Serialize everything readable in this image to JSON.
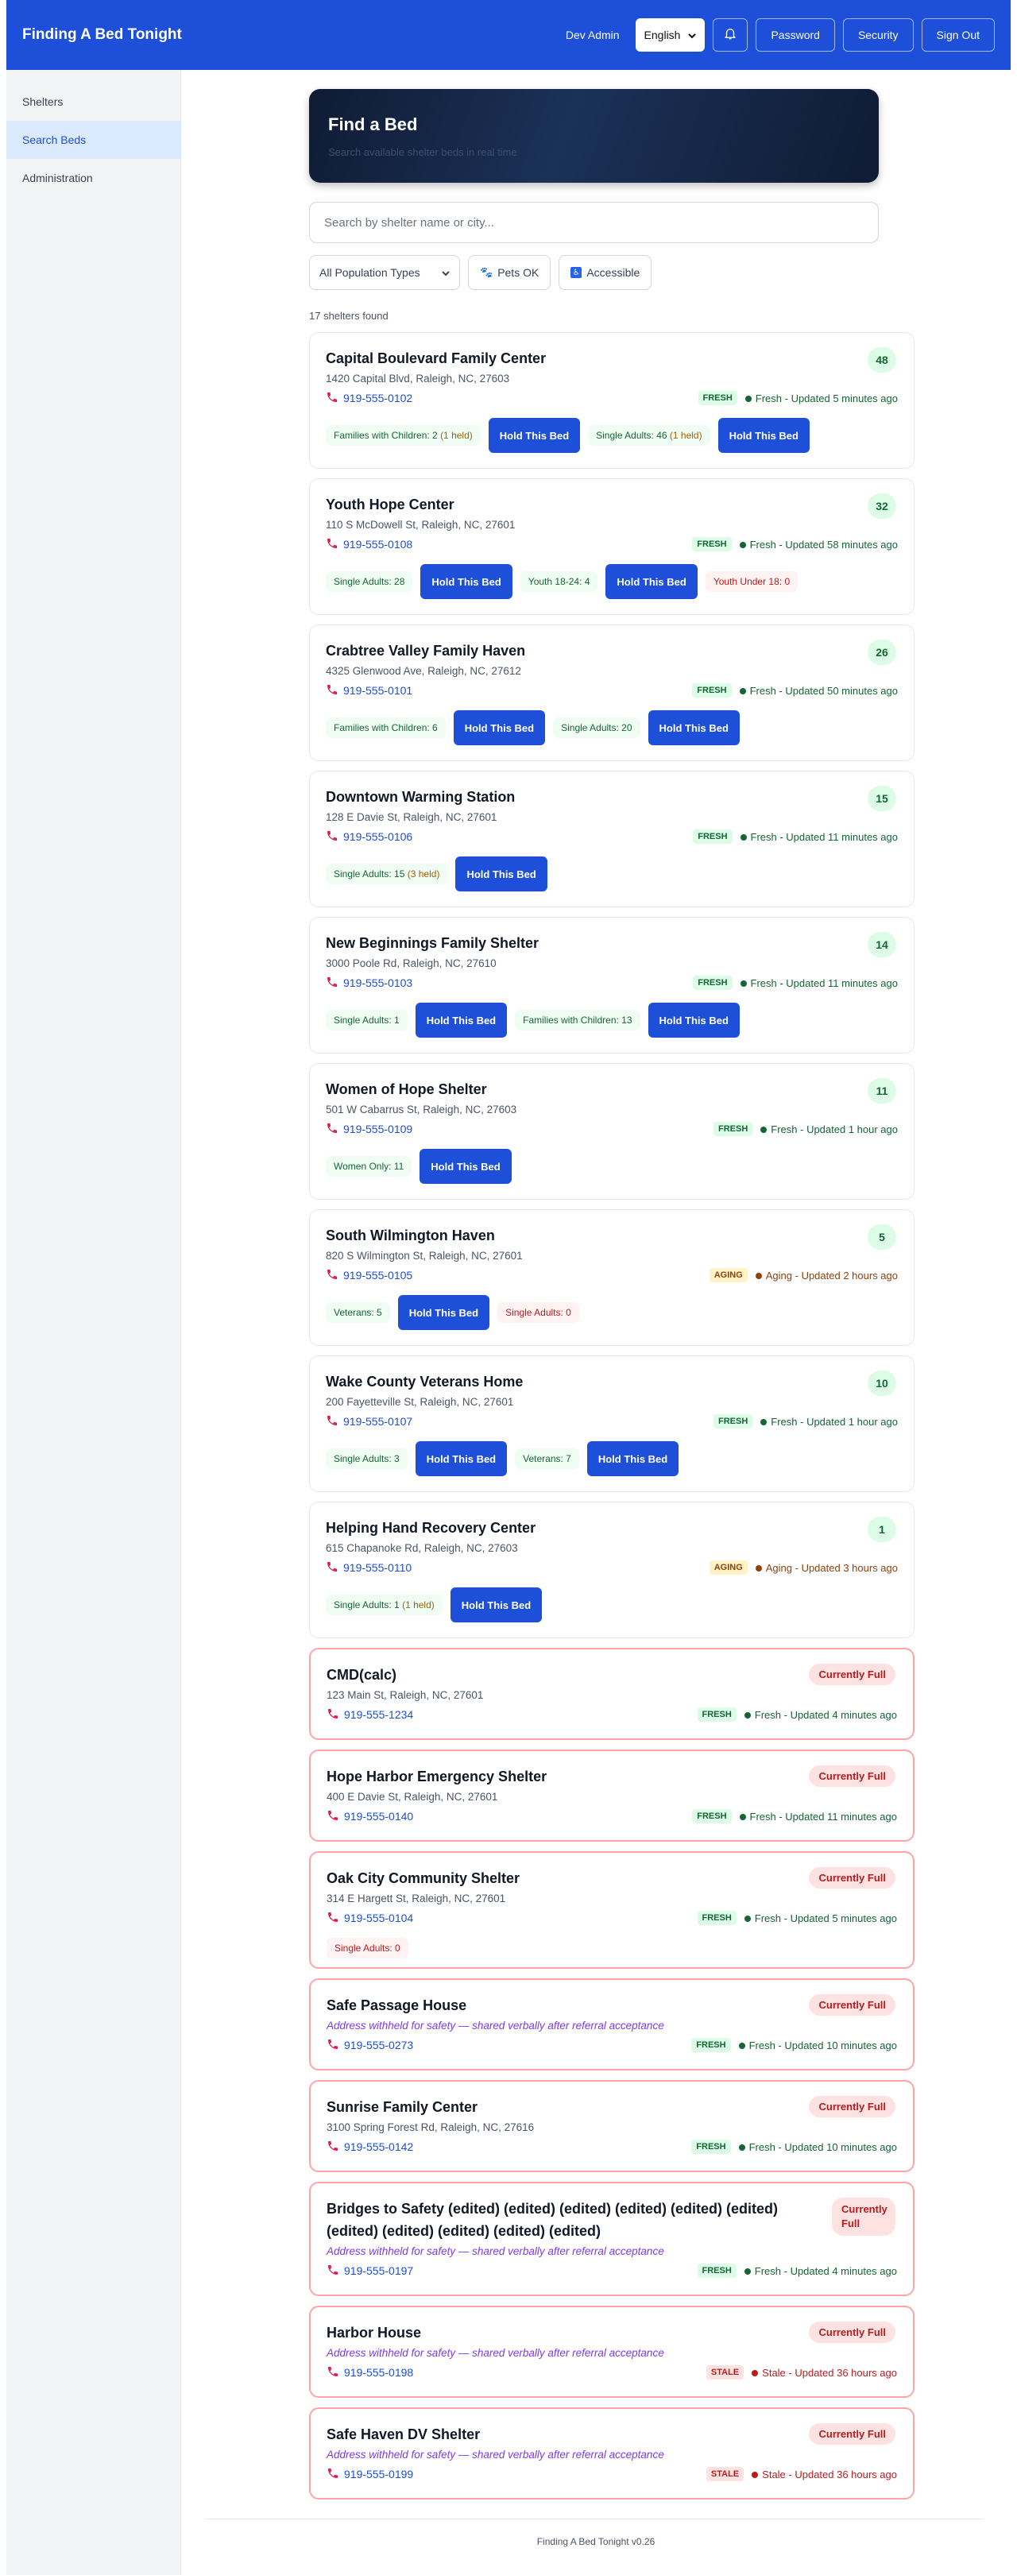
{
  "header": {
    "app_title": "Finding A Bed Tonight",
    "user": "Dev Admin",
    "language": "English",
    "buttons": {
      "password": "Password",
      "security": "Security",
      "signout": "Sign Out"
    },
    "bell_icon": "bell-icon"
  },
  "sidebar": {
    "items": [
      {
        "label": "Shelters",
        "active": false
      },
      {
        "label": "Search Beds",
        "active": true
      },
      {
        "label": "Administration",
        "active": false
      }
    ]
  },
  "hero": {
    "title": "Find a Bed",
    "subtitle": "Search available shelter beds in real time"
  },
  "search": {
    "placeholder": "Search by shelter name or city..."
  },
  "filters": {
    "population": "All Population Types",
    "pets": "Pets OK",
    "accessible": "Accessible"
  },
  "results_count": "17 shelters found",
  "hold_label": "Hold This Bed",
  "full_label": "Currently Full",
  "shelters": [
    {
      "name": "Capital Boulevard Family Center",
      "address": "1420 Capital Blvd, Raleigh, NC, 27603",
      "phone": "919-555-0102",
      "beds": "48",
      "freshness_tag": "FRESH",
      "freshness_text": "Fresh - Updated 5 minutes ago",
      "avail": [
        {
          "label": "Families with Children: 2",
          "held": "(1 held)"
        },
        {
          "label": "Single Adults: 46",
          "held": "(1 held)"
        }
      ]
    },
    {
      "name": "Youth Hope Center",
      "address": "110 S McDowell St, Raleigh, NC, 27601",
      "phone": "919-555-0108",
      "beds": "32",
      "freshness_tag": "FRESH",
      "freshness_text": "Fresh - Updated 58 minutes ago",
      "avail": [
        {
          "label": "Single Adults: 28"
        },
        {
          "label": "Youth 18-24: 4"
        }
      ],
      "none": "Youth Under 18: 0"
    },
    {
      "name": "Crabtree Valley Family Haven",
      "address": "4325 Glenwood Ave, Raleigh, NC, 27612",
      "phone": "919-555-0101",
      "beds": "26",
      "freshness_tag": "FRESH",
      "freshness_text": "Fresh - Updated 50 minutes ago",
      "avail": [
        {
          "label": "Families with Children: 6"
        },
        {
          "label": "Single Adults: 20"
        }
      ]
    },
    {
      "name": "Downtown Warming Station",
      "address": "128 E Davie St, Raleigh, NC, 27601",
      "phone": "919-555-0106",
      "beds": "15",
      "freshness_tag": "FRESH",
      "freshness_text": "Fresh - Updated 11 minutes ago",
      "avail": [
        {
          "label": "Single Adults: 15",
          "held": "(3 held)"
        }
      ]
    },
    {
      "name": "New Beginnings Family Shelter",
      "address": "3000 Poole Rd, Raleigh, NC, 27610",
      "phone": "919-555-0103",
      "beds": "14",
      "freshness_tag": "FRESH",
      "freshness_text": "Fresh - Updated 11 minutes ago",
      "avail": [
        {
          "label": "Single Adults: 1"
        },
        {
          "label": "Families with Children: 13"
        }
      ]
    },
    {
      "name": "Women of Hope Shelter",
      "address": "501 W Cabarrus St, Raleigh, NC, 27603",
      "phone": "919-555-0109",
      "beds": "11",
      "freshness_tag": "FRESH",
      "freshness_text": "Fresh - Updated 1 hour ago",
      "avail": [
        {
          "label": "Women Only: 11"
        }
      ]
    },
    {
      "name": "South Wilmington Haven",
      "address": "820 S Wilmington St, Raleigh, NC, 27601",
      "phone": "919-555-0105",
      "beds": "5",
      "freshness_tag": "AGING",
      "freshness_text": "Aging - Updated 2 hours ago",
      "avail": [
        {
          "label": "Veterans: 5"
        }
      ],
      "none": "Single Adults: 0"
    },
    {
      "name": "Wake County Veterans Home",
      "address": "200 Fayetteville St, Raleigh, NC, 27601",
      "phone": "919-555-0107",
      "beds": "10",
      "freshness_tag": "FRESH",
      "freshness_text": "Fresh - Updated 1 hour ago",
      "avail": [
        {
          "label": "Single Adults: 3"
        },
        {
          "label": "Veterans: 7"
        }
      ]
    },
    {
      "name": "Helping Hand Recovery Center",
      "address": "615 Chapanoke Rd, Raleigh, NC, 27603",
      "phone": "919-555-0110",
      "beds": "1",
      "freshness_tag": "AGING",
      "freshness_text": "Aging - Updated 3 hours ago",
      "avail": [
        {
          "label": "Single Adults: 1",
          "held": "(1 held)"
        }
      ]
    },
    {
      "name": "CMD(calc)",
      "address": "123 Main St, Raleigh, NC, 27601",
      "phone": "919-555-1234",
      "full": true,
      "freshness_tag": "FRESH",
      "freshness_text": "Fresh - Updated 4 minutes ago"
    },
    {
      "name": "Hope Harbor Emergency Shelter",
      "address": "400 E Davie St, Raleigh, NC, 27601",
      "phone": "919-555-0140",
      "full": true,
      "freshness_tag": "FRESH",
      "freshness_text": "Fresh - Updated 11 minutes ago"
    },
    {
      "name": "Oak City Community Shelter",
      "address": "314 E Hargett St, Raleigh, NC, 27601",
      "phone": "919-555-0104",
      "full": true,
      "freshness_tag": "FRESH",
      "freshness_text": "Fresh - Updated 5 minutes ago",
      "none": "Single Adults: 0"
    },
    {
      "name": "Safe Passage House",
      "address": "Address withheld for safety — shared verbally after referral acceptance",
      "withheld": true,
      "phone": "919-555-0273",
      "full": true,
      "freshness_tag": "FRESH",
      "freshness_text": "Fresh - Updated 10 minutes ago"
    },
    {
      "name": "Sunrise Family Center",
      "address": "3100 Spring Forest Rd, Raleigh, NC, 27616",
      "phone": "919-555-0142",
      "full": true,
      "freshness_tag": "FRESH",
      "freshness_text": "Fresh - Updated 10 minutes ago"
    },
    {
      "name": "Bridges to Safety (edited) (edited) (edited) (edited) (edited) (edited) (edited) (edited) (edited) (edited) (edited)",
      "address": "Address withheld for safety — shared verbally after referral acceptance",
      "withheld": true,
      "phone": "919-555-0197",
      "full": true,
      "freshness_tag": "FRESH",
      "freshness_text": "Fresh - Updated 4 minutes ago"
    },
    {
      "name": "Harbor House",
      "address": "Address withheld for safety — shared verbally after referral acceptance",
      "withheld": true,
      "phone": "919-555-0198",
      "full": true,
      "freshness_tag": "STALE",
      "freshness_text": "Stale - Updated 36 hours ago"
    },
    {
      "name": "Safe Haven DV Shelter",
      "address": "Address withheld for safety — shared verbally after referral acceptance",
      "withheld": true,
      "phone": "919-555-0199",
      "full": true,
      "freshness_tag": "STALE",
      "freshness_text": "Stale - Updated 36 hours ago"
    }
  ],
  "footer": "Finding A Bed Tonight v0.26"
}
